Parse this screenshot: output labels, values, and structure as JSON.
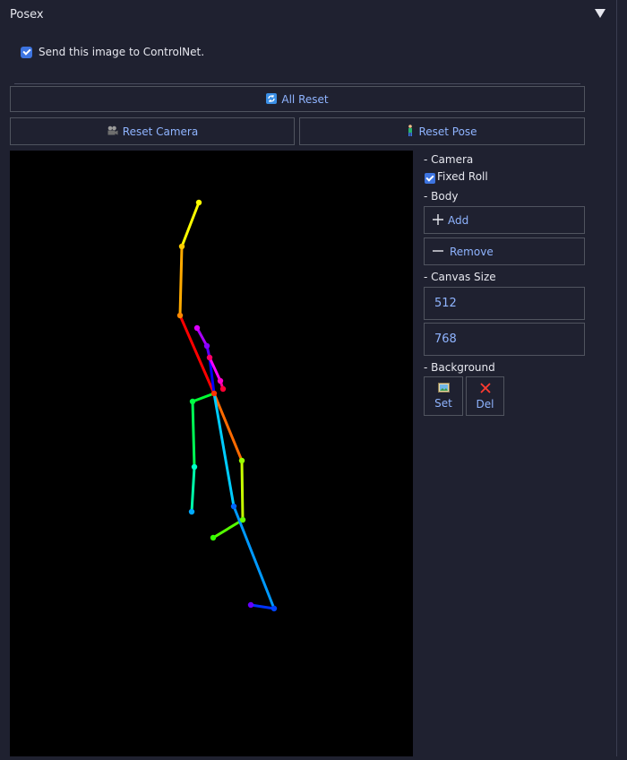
{
  "panel": {
    "title": "Posex"
  },
  "send_checkbox": {
    "label": "Send this image to ControlNet.",
    "checked": true
  },
  "buttons": {
    "all_reset": "All Reset",
    "reset_camera": "Reset Camera",
    "reset_pose": "Reset Pose"
  },
  "sidebar": {
    "camera_heading": "- Camera",
    "fixed_roll_label": "Fixed Roll",
    "fixed_roll_checked": true,
    "body_heading": "- Body",
    "add_label": "Add",
    "remove_label": "Remove",
    "canvas_size_heading": "- Canvas Size",
    "width_value": "512",
    "height_value": "768",
    "background_heading": "- Background",
    "bg_set_label": "Set",
    "bg_del_label": "Del"
  },
  "icons": {
    "collapse": "triangle-down-icon",
    "all_reset": "refresh-icon",
    "reset_camera": "camera-icon",
    "reset_pose": "person-icon",
    "add": "plus-icon",
    "remove": "minus-icon",
    "bg_set": "image-icon",
    "bg_del": "x-icon"
  },
  "colors": {
    "panel_bg": "#1f2130",
    "accent_text": "#8fb4ff",
    "checkbox": "#3d74e0",
    "canvas_bg": "#000000"
  }
}
